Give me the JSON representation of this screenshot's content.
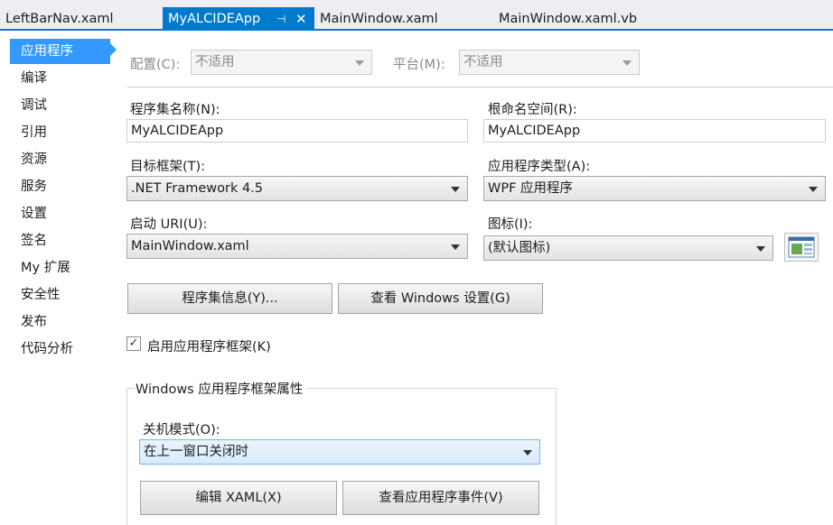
{
  "tabs": [
    {
      "label": "LeftBarNav.xaml",
      "active": false
    },
    {
      "label": "MyALCIDEApp",
      "active": true
    },
    {
      "label": "MainWindow.xaml",
      "active": false
    },
    {
      "label": "MainWindow.xaml.vb",
      "active": false
    }
  ],
  "active_tab_icons": {
    "pin": "pin-icon",
    "close": "close-icon"
  },
  "nav": {
    "items": [
      "应用程序",
      "编译",
      "调试",
      "引用",
      "资源",
      "服务",
      "设置",
      "签名",
      "My 扩展",
      "安全性",
      "发布",
      "代码分析"
    ],
    "selected": "应用程序"
  },
  "config": {
    "label": "配置(C):",
    "value": "不适用"
  },
  "platform": {
    "label": "平台(M):",
    "value": "不适用"
  },
  "assembly_name": {
    "label": "程序集名称(N):",
    "value": "MyALCIDEApp"
  },
  "root_namespace": {
    "label": "根命名空间(R):",
    "value": "MyALCIDEApp"
  },
  "target_framework": {
    "label": "目标框架(T):",
    "value": ".NET Framework 4.5"
  },
  "app_type": {
    "label": "应用程序类型(A):",
    "value": "WPF 应用程序"
  },
  "startup_uri": {
    "label": "启动 URI(U):",
    "value": "MainWindow.xaml"
  },
  "icon": {
    "label": "图标(I):",
    "value": "(默认图标)",
    "preview": "app-icon-preview"
  },
  "buttons": {
    "assembly_info": "程序集信息(Y)...",
    "windows_settings": "查看 Windows 设置(G)",
    "edit_xaml": "编辑 XAML(X)",
    "view_app_events": "查看应用程序事件(V)"
  },
  "enable_framework": {
    "label": "启用应用程序框架(K)",
    "checked": true
  },
  "framework_group": {
    "title": "Windows 应用程序框架属性",
    "shutdown_mode": {
      "label": "关机模式(O):",
      "value": "在上一窗口关闭时"
    }
  },
  "colors": {
    "accent": "#007acc",
    "nav_selected": "#3399ff"
  }
}
